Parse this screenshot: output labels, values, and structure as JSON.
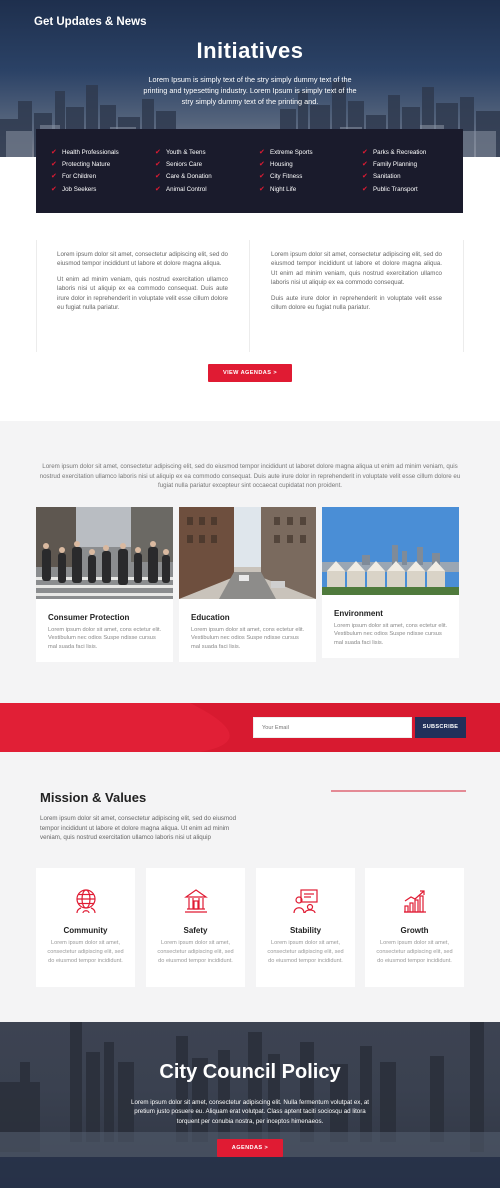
{
  "hero": {
    "title": "Initiatives",
    "text": "Lorem Ipsum is simply text of the stry simply dummy text of the printing and typesetting industry. Lorem Ipsum is simply text of the stry simply dummy text of the printing and."
  },
  "initiatives": {
    "columns": [
      [
        "Health Professionals",
        "Protecting Nature",
        "For Children",
        "Job Seekers"
      ],
      [
        "Youth & Teens",
        "Seniors Care",
        "Care & Donation",
        "Animal Control"
      ],
      [
        "Extreme Sports",
        "Housing",
        "City Fitness",
        "Night Life"
      ],
      [
        "Parks & Recreation",
        "Family Planning",
        "Sanitation",
        "Public Transport"
      ]
    ]
  },
  "about": {
    "left_p1": "Lorem ipsum dolor sit amet, consectetur adipiscing elit, sed do eiusmod tempor incididunt ut labore et dolore magna aliqua.",
    "left_p2": "Ut enim ad minim veniam, quis nostrud exercitation ullamco laboris nisi ut aliquip ex ea commodo consequat. Duis aute irure dolor in reprehenderit in voluptate velit esse cillum dolore eu fugiat nulla pariatur.",
    "right_p1": "Lorem ipsum dolor sit amet, consectetur adipiscing elit, sed do eiusmod tempor incididunt ut labore et dolore magna aliqua. Ut enim ad minim veniam, quis nostrud exercitation ullamco laboris nisi ut aliquip ex ea commodo consequat.",
    "right_p2": "Duis aute irure dolor in reprehenderit in voluptate velit esse cillum dolore eu fugiat nulla pariatur.",
    "button": "VIEW AGENDAS >"
  },
  "services": {
    "intro": "Lorem ipsum dolor sit amet, consectetur adipiscing elit, sed do eiusmod tempor incididunt ut laboret dolore magna aliqua ut enim ad minim veniam, quis nostrud exercitation ullamco laboris nisi ut aliquip ex ea commodo consequat. Duis aute irure dolor in reprehenderit in voluptate velit esse cillum dolore eu fugiat nulla pariatur excepteur sint occaecat cupidatat non proident.",
    "cards": [
      {
        "title": "Consumer Protection",
        "text": "Lorem ipsum dolor sit amet, cons ectetur elit. Vestibulum nec odios Suspe ndisse cursus mal suada faci lisis."
      },
      {
        "title": "Education",
        "text": "Lorem ipsum dolor sit amet, cons ectetur elit. Vestibulum nec odios Suspe ndisse cursus mal suada faci lisis."
      },
      {
        "title": "Environment",
        "text": "Lorem ipsum dolor sit amet, cons ectetur elit. Vestibulum nec odios Suspe ndisse cursus mal suada faci lisis."
      }
    ]
  },
  "newsletter": {
    "title": "Get Updates & News",
    "placeholder": "Your Email",
    "button": "SUBSCRIBE"
  },
  "mission": {
    "title": "Mission & Values",
    "text": "Lorem ipsum dolor sit amet, consectetur adipiscing elit, sed do eiusmod tempor incididunt ut labore et dolore magna aliqua. Ut enim ad minim veniam, quis nostrud exercitation ullamco laboris nisi ut aliquip",
    "values": [
      {
        "title": "Community",
        "text": "Lorem ipsum dolor sit amet, consectetur adipiscing elit, sed do eiusmod tempor incididunt.",
        "icon": "globe-people-icon"
      },
      {
        "title": "Safety",
        "text": "Lorem ipsum dolor sit amet, consectetur adipiscing elit, sed do eiusmod tempor incididunt.",
        "icon": "building-icon"
      },
      {
        "title": "Stability",
        "text": "Lorem ipsum dolor sit amet, consectetur adipiscing elit, sed do eiusmod tempor incididunt.",
        "icon": "presentation-icon"
      },
      {
        "title": "Growth",
        "text": "Lorem ipsum dolor sit amet, consectetur adipiscing elit, sed do eiusmod tempor incididunt.",
        "icon": "growth-chart-icon"
      }
    ]
  },
  "footer": {
    "title": "City Council Policy",
    "text": "Lorem ipsum dolor sit amet, consectetur adipiscing elit. Nulla fermentum volutpat ex, at pretium justo posuere eu. Aliquam erat volutpat. Class aptent taciti sociosqu ad litora torquent per conubia nostra, per inceptos himenaeos.",
    "button": "AGENDAS >"
  },
  "colors": {
    "accent": "#e01b33",
    "navy": "#22305a",
    "dark": "#1a1b2c"
  }
}
